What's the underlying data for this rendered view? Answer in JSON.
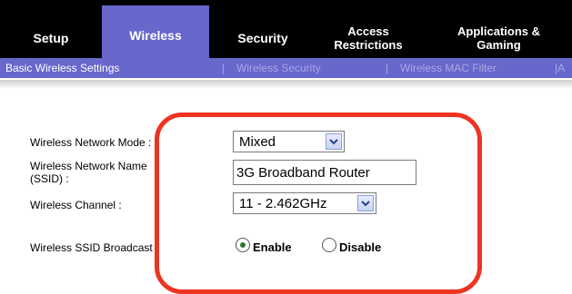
{
  "nav": {
    "tabs": [
      {
        "label": "Setup"
      },
      {
        "label": "Wireless"
      },
      {
        "label": "Security"
      },
      {
        "label": "Access Restrictions"
      },
      {
        "label": "Applications & Gaming"
      }
    ]
  },
  "subnav": {
    "items": [
      {
        "label": "Basic Wireless Settings"
      },
      {
        "label": "|"
      },
      {
        "label": "Wireless Security"
      },
      {
        "label": "|"
      },
      {
        "label": "Wireless MAC Filter"
      },
      {
        "label": "|A"
      }
    ]
  },
  "form": {
    "network_mode_label": "Wireless Network Mode :",
    "network_mode_value": "Mixed",
    "network_name_label_line1": "Wireless Network Name",
    "network_name_label_line2": "(SSID) :",
    "network_name_value": "3G Broadband Router",
    "channel_label": "Wireless Channel :",
    "channel_value": "11 - 2.462GHz",
    "ssid_broadcast_label": "Wireless SSID Broadcast :",
    "enable_label": "Enable",
    "disable_label": "Disable"
  },
  "colors": {
    "nav_active": "#6767cc",
    "highlight": "#ee3322"
  }
}
